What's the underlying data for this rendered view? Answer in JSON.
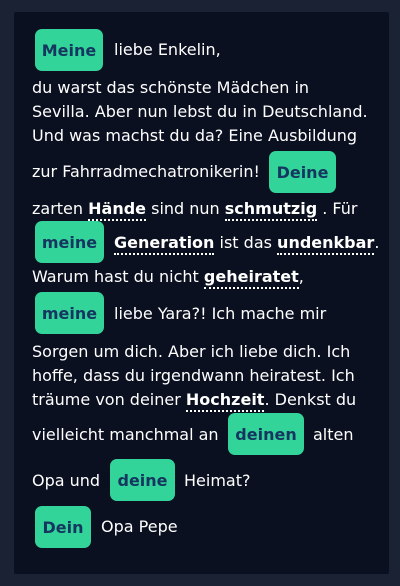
{
  "colors": {
    "background": "#1b2233",
    "card": "#0b1020",
    "chip": "#33d49a",
    "chip_text": "#14365f",
    "text": "#ffffff"
  },
  "letter": {
    "chips": [
      "Meine",
      "Deine",
      "meine",
      "meine",
      "deinen",
      "deine",
      "Dein"
    ],
    "greeting": "liebe Enkelin,",
    "line2": "du warst das schönste Mädchen in",
    "line3": "Sevilla. Aber nun lebst du in Deutschland.",
    "line4": "Und was machst du da? Eine Ausbildung",
    "line5": "zur Fahrradmechatronikerin!",
    "t_zarten": "zarten ",
    "w_haende": "Hände",
    "t_sind_nun": " sind nun ",
    "w_schmutzig": "schmutzig",
    "t_fuer": " . Für",
    "w_generation": "Generation",
    "t_ist_das": " ist das ",
    "w_undenkbar": "undenkbar",
    "t_dot": ".",
    "t_warum": "Warum hast du nicht ",
    "w_geheiratet": "geheiratet",
    "t_comma": ",",
    "t_liebe_yara": "liebe Yara?! Ich mache mir",
    "line_sorgen": "Sorgen um dich. Aber ich liebe dich. Ich",
    "line_hoffe": "hoffe, dass du irgendwann heiratest. Ich",
    "t_traeume": "träume von deiner ",
    "w_hochzeit": "Hochzeit",
    "t_denkst": ". Denkst du",
    "t_vielleicht": "vielleicht manchmal an",
    "t_alten": "alten",
    "t_opa_und": "Opa und",
    "t_heimat": "Heimat?",
    "t_opa_pepe": "Opa Pepe"
  }
}
